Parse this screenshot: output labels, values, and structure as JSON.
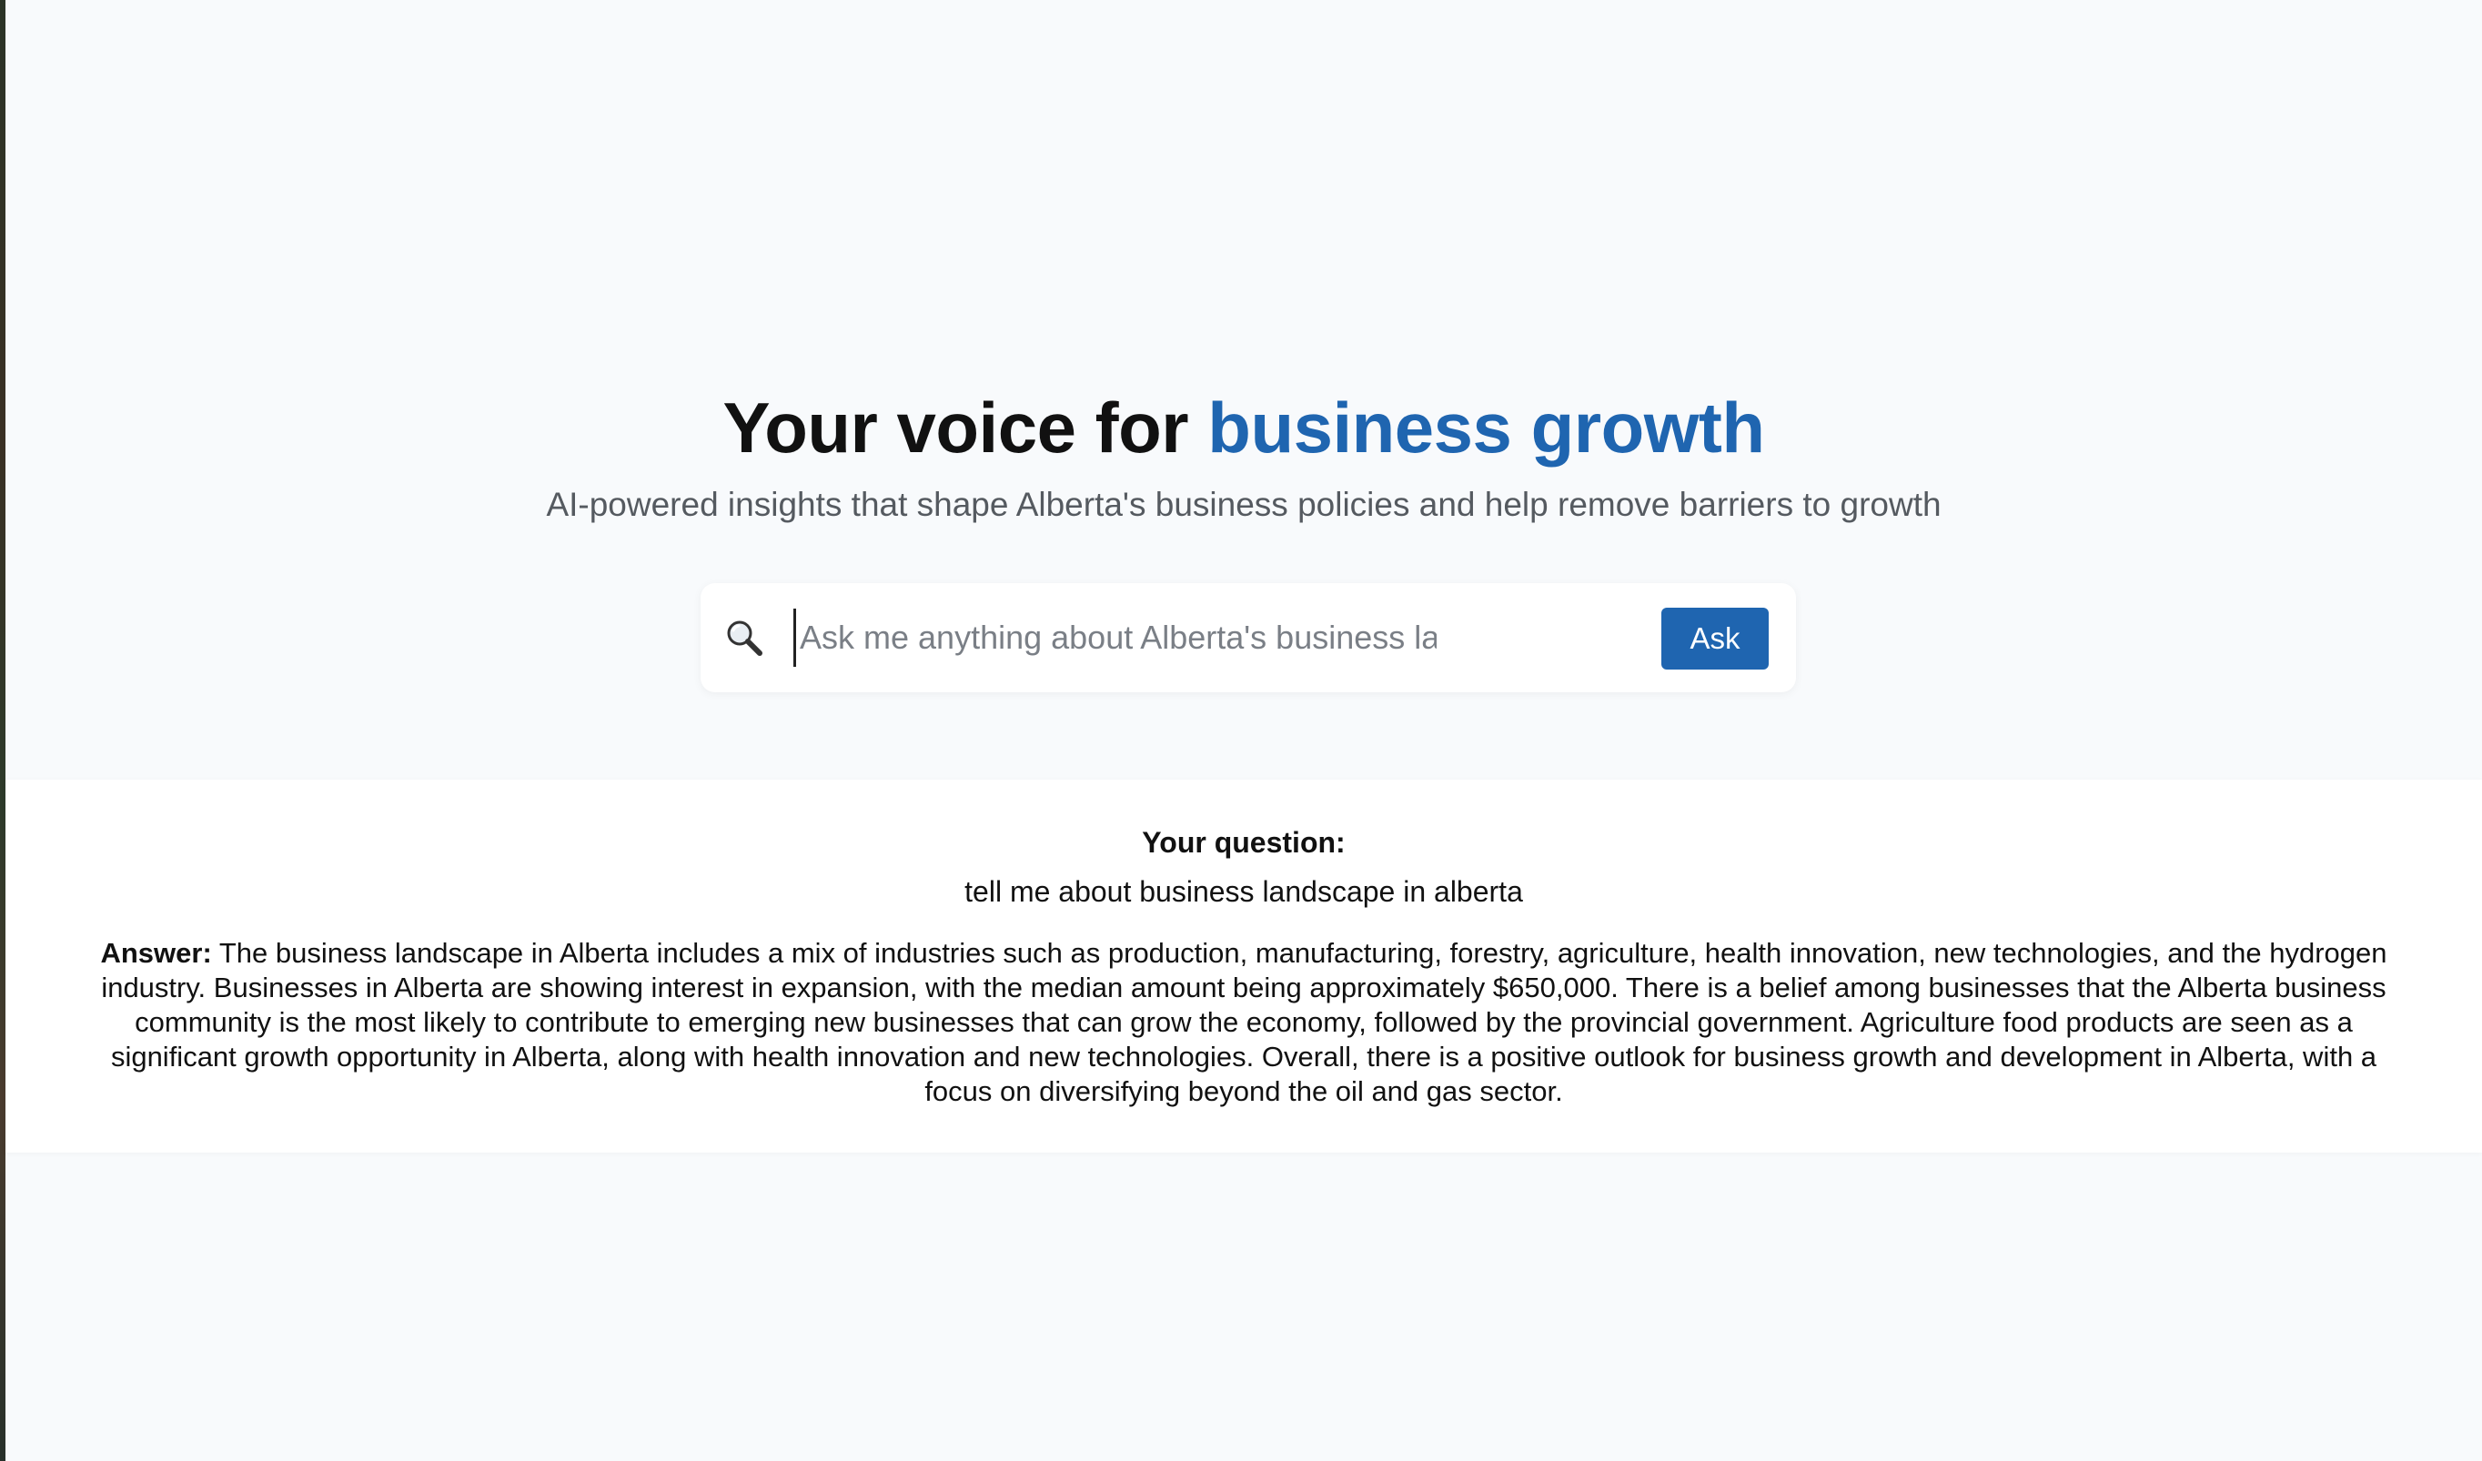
{
  "hero": {
    "title_prefix": "Your voice for ",
    "title_accent": "business growth",
    "subtitle": "AI-powered insights that shape Alberta's business policies and help remove barriers to growth"
  },
  "search": {
    "icon": "magnifier-icon",
    "placeholder": "Ask me anything about Alberta's business landscape...",
    "value": "",
    "button_label": "Ask"
  },
  "result": {
    "question_label": "Your question:",
    "question_text": "tell me about business landscape in alberta",
    "answer_label": "Answer:",
    "answer_text": " The business landscape in Alberta includes a mix of industries such as production, manufacturing, forestry, agriculture, health innovation, new technologies, and the hydrogen industry. Businesses in Alberta are showing interest in expansion, with the median amount being approximately $650,000. There is a belief among businesses that the Alberta business community is the most likely to contribute to emerging new businesses that can grow the economy, followed by the provincial government. Agriculture food products are seen as a significant growth opportunity in Alberta, along with health innovation and new technologies. Overall, there is a positive outlook for business growth and development in Alberta, with a focus on diversifying beyond the oil and gas sector."
  },
  "colors": {
    "accent": "#1f65b0",
    "background": "#f8fafc",
    "panel": "#ffffff"
  }
}
